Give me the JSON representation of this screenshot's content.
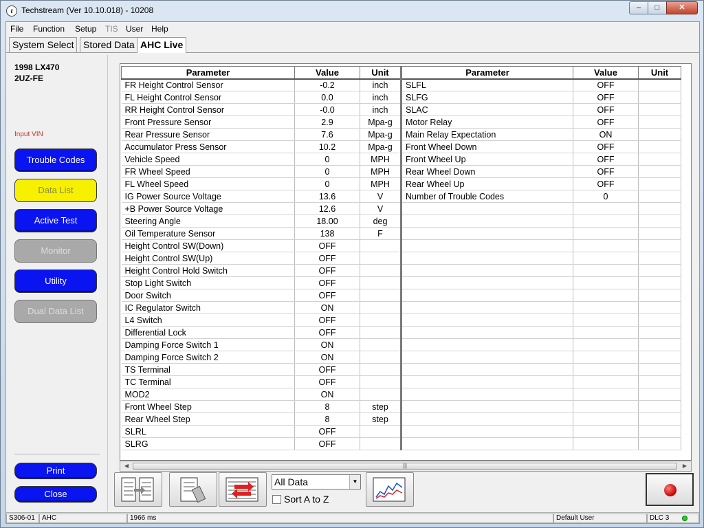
{
  "window": {
    "title": "Techstream (Ver 10.10.018) - 10208",
    "app_icon_glyph": "t"
  },
  "menu": [
    "File",
    "Function",
    "Setup",
    "TIS",
    "User",
    "Help"
  ],
  "tabs": [
    "System Select",
    "Stored Data",
    "AHC Live"
  ],
  "active_tab": "AHC Live",
  "vehicle": {
    "model": "1998 LX470",
    "engine": "2UZ-FE"
  },
  "sidebar": {
    "input_vin": "Input VIN",
    "trouble_codes": "Trouble Codes",
    "data_list": "Data List",
    "active_test": "Active Test",
    "monitor": "Monitor",
    "utility": "Utility",
    "dual_data_list": "Dual Data List",
    "print": "Print",
    "close": "Close"
  },
  "table": {
    "headers": {
      "parameter": "Parameter",
      "value": "Value",
      "unit": "Unit"
    },
    "left": [
      {
        "p": "FR Height Control Sensor",
        "v": "-0.2",
        "u": "inch"
      },
      {
        "p": "FL Height Control Sensor",
        "v": "0.0",
        "u": "inch"
      },
      {
        "p": "RR Height Control Sensor",
        "v": "-0.0",
        "u": "inch"
      },
      {
        "p": "Front Pressure Sensor",
        "v": "2.9",
        "u": "Mpa-g"
      },
      {
        "p": "Rear Pressure Sensor",
        "v": "7.6",
        "u": "Mpa-g"
      },
      {
        "p": "Accumulator Press Sensor",
        "v": "10.2",
        "u": "Mpa-g"
      },
      {
        "p": "Vehicle Speed",
        "v": "0",
        "u": "MPH"
      },
      {
        "p": "FR Wheel Speed",
        "v": "0",
        "u": "MPH"
      },
      {
        "p": "FL Wheel Speed",
        "v": "0",
        "u": "MPH"
      },
      {
        "p": "IG Power Source Voltage",
        "v": "13.6",
        "u": "V"
      },
      {
        "p": "+B Power Source Voltage",
        "v": "12.6",
        "u": "V"
      },
      {
        "p": "Steering Angle",
        "v": "18.00",
        "u": "deg"
      },
      {
        "p": "Oil Temperature Sensor",
        "v": "138",
        "u": "F"
      },
      {
        "p": "Height Control SW(Down)",
        "v": "OFF",
        "u": ""
      },
      {
        "p": "Height Control SW(Up)",
        "v": "OFF",
        "u": ""
      },
      {
        "p": "Height Control Hold Switch",
        "v": "OFF",
        "u": ""
      },
      {
        "p": "Stop Light Switch",
        "v": "OFF",
        "u": ""
      },
      {
        "p": "Door Switch",
        "v": "OFF",
        "u": ""
      },
      {
        "p": "IC Regulator Switch",
        "v": "ON",
        "u": ""
      },
      {
        "p": "L4 Switch",
        "v": "OFF",
        "u": ""
      },
      {
        "p": "Differential Lock",
        "v": "OFF",
        "u": ""
      },
      {
        "p": "Damping Force Switch 1",
        "v": "ON",
        "u": ""
      },
      {
        "p": "Damping Force Switch 2",
        "v": "ON",
        "u": ""
      },
      {
        "p": "TS Terminal",
        "v": "OFF",
        "u": ""
      },
      {
        "p": "TC Terminal",
        "v": "OFF",
        "u": ""
      },
      {
        "p": "MOD2",
        "v": "ON",
        "u": ""
      },
      {
        "p": "Front Wheel Step",
        "v": "8",
        "u": "step"
      },
      {
        "p": "Rear Wheel Step",
        "v": "8",
        "u": "step"
      },
      {
        "p": "SLRL",
        "v": "OFF",
        "u": ""
      },
      {
        "p": "SLRG",
        "v": "OFF",
        "u": ""
      }
    ],
    "right": [
      {
        "p": "SLFL",
        "v": "OFF",
        "u": ""
      },
      {
        "p": "SLFG",
        "v": "OFF",
        "u": ""
      },
      {
        "p": "SLAC",
        "v": "OFF",
        "u": ""
      },
      {
        "p": "Motor Relay",
        "v": "OFF",
        "u": ""
      },
      {
        "p": "Main Relay Expectation",
        "v": "ON",
        "u": ""
      },
      {
        "p": "Front Wheel Down",
        "v": "OFF",
        "u": ""
      },
      {
        "p": "Front Wheel Up",
        "v": "OFF",
        "u": ""
      },
      {
        "p": "Rear Wheel Down",
        "v": "OFF",
        "u": ""
      },
      {
        "p": "Rear Wheel Up",
        "v": "OFF",
        "u": ""
      },
      {
        "p": "Number of Trouble Codes",
        "v": "0",
        "u": ""
      }
    ]
  },
  "toolbar": {
    "filter_value": "All Data",
    "sort_label": "Sort A to Z",
    "sort_checked": false,
    "icons": [
      "list-select-icon",
      "manual-icon",
      "refresh-list-icon",
      "graph-icon",
      "record-icon"
    ]
  },
  "status": {
    "code": "S306-01",
    "system": "AHC",
    "timing": "1966 ms",
    "user": "Default User",
    "dlc": "DLC 3",
    "dlc_color": "#1fd11f"
  },
  "colors": {
    "button_blue": "#0a14f0",
    "button_yellow": "#f7f000",
    "button_gray": "#a9a9a9",
    "record_red": "#c00000"
  }
}
